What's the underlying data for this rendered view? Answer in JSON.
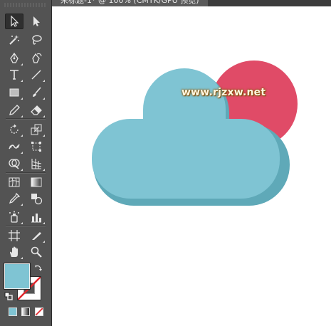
{
  "document": {
    "tab_title": "未标题-1* @ 100% (CMYK/GPU 预览)"
  },
  "toolbar": {
    "tools": [
      {
        "id": "selection",
        "icon": "selection-arrow-icon",
        "active": true
      },
      {
        "id": "direct-selection",
        "icon": "direct-selection-arrow-icon"
      },
      {
        "id": "magic-wand",
        "icon": "magic-wand-icon"
      },
      {
        "id": "lasso",
        "icon": "lasso-icon"
      },
      {
        "id": "pen",
        "icon": "pen-icon"
      },
      {
        "id": "curvature",
        "icon": "curvature-pen-icon"
      },
      {
        "id": "type",
        "icon": "type-icon",
        "glyph": "T"
      },
      {
        "id": "line-segment",
        "icon": "line-segment-icon"
      },
      {
        "id": "rectangle",
        "icon": "rectangle-icon"
      },
      {
        "id": "paintbrush",
        "icon": "paintbrush-icon"
      },
      {
        "id": "pencil",
        "icon": "pencil-icon"
      },
      {
        "id": "eraser",
        "icon": "eraser-icon"
      },
      {
        "id": "rotate",
        "icon": "rotate-icon"
      },
      {
        "id": "scale",
        "icon": "scale-icon"
      },
      {
        "id": "puppet-warp",
        "icon": "puppet-warp-icon"
      },
      {
        "id": "free-transform",
        "icon": "free-transform-icon"
      },
      {
        "id": "shape-builder",
        "icon": "shape-builder-icon"
      },
      {
        "id": "perspective-grid",
        "icon": "perspective-grid-icon"
      },
      {
        "id": "mesh",
        "icon": "mesh-icon"
      },
      {
        "id": "gradient",
        "icon": "gradient-icon"
      },
      {
        "id": "eyedropper",
        "icon": "eyedropper-icon"
      },
      {
        "id": "blend",
        "icon": "blend-icon"
      },
      {
        "id": "symbol-sprayer",
        "icon": "symbol-sprayer-icon"
      },
      {
        "id": "column-graph",
        "icon": "column-graph-icon"
      },
      {
        "id": "artboard",
        "icon": "artboard-icon"
      },
      {
        "id": "slice",
        "icon": "slice-icon"
      },
      {
        "id": "hand",
        "icon": "hand-icon"
      },
      {
        "id": "zoom",
        "icon": "zoom-icon"
      }
    ],
    "fill_color": "#7fc4d3",
    "stroke": "none"
  },
  "artwork": {
    "sun_color": "#e04b67",
    "cloud_color": "#7fc4d3",
    "cloud_shadow_color": "#5fa9b8",
    "watermark": "www.rjzxw.net"
  }
}
